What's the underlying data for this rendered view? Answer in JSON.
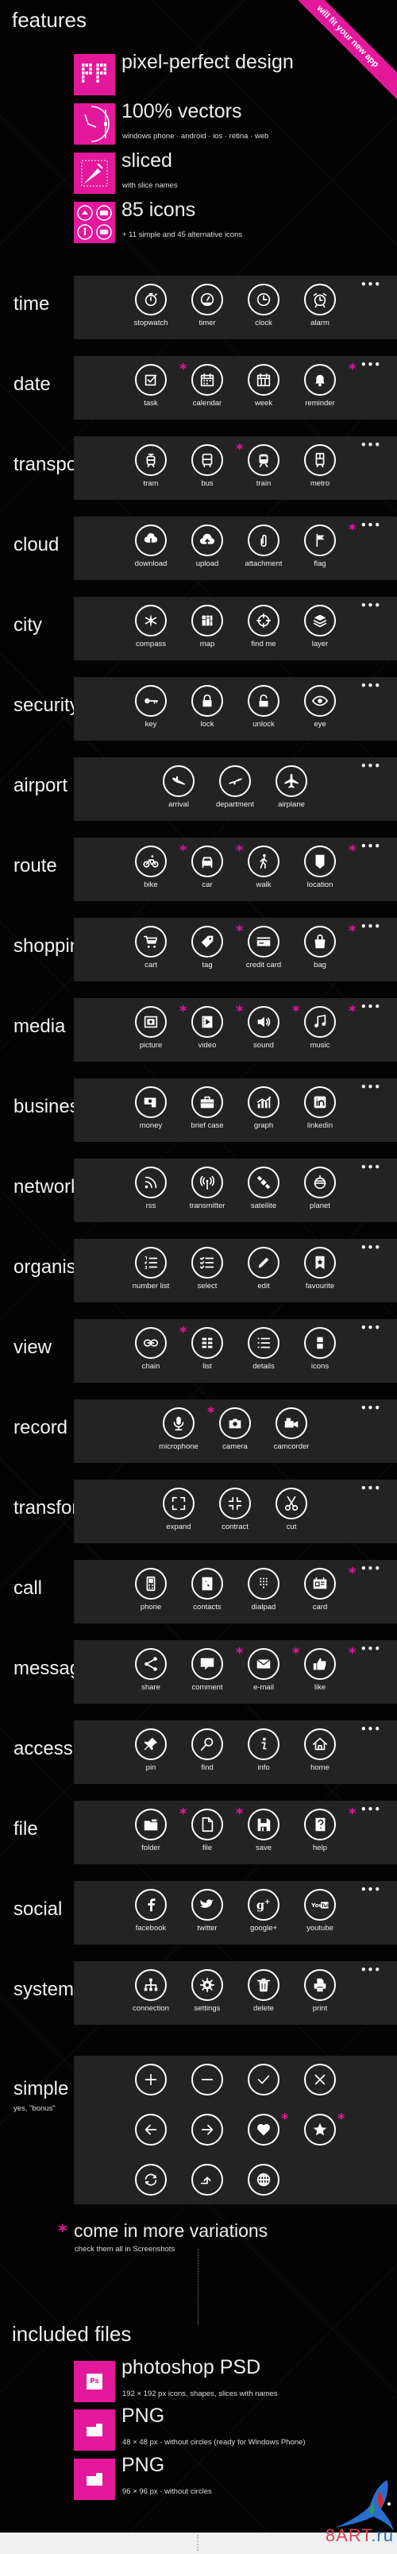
{
  "colors": {
    "accent": "#e3189b",
    "panel": "#232323",
    "background": "#030303"
  },
  "header": {
    "title": "features",
    "ribbon": "will fit your new app"
  },
  "features": [
    {
      "title": "pixel-perfect design",
      "subtitle": "",
      "icon": "pixel-pp-icon"
    },
    {
      "title": "100% vectors",
      "subtitle": "windows phone · android · ios · retina · web",
      "icon": "vector-path-icon"
    },
    {
      "title": "sliced",
      "subtitle": "with slice names",
      "icon": "slice-knife-icon"
    },
    {
      "title": "85 icons",
      "subtitle": "+ 11 simple and 45 alternative icons",
      "icon": "icon-grid-icon"
    }
  ],
  "more_label": "•••",
  "variant_marker": "*",
  "categories": [
    {
      "name": "time",
      "items": [
        {
          "label": "stopwatch",
          "icon": "stopwatch",
          "variant": false
        },
        {
          "label": "timer",
          "icon": "timer",
          "variant": false
        },
        {
          "label": "clock",
          "icon": "clock",
          "variant": false
        },
        {
          "label": "alarm",
          "icon": "alarm",
          "variant": false
        }
      ]
    },
    {
      "name": "date",
      "items": [
        {
          "label": "task",
          "icon": "task",
          "variant": true
        },
        {
          "label": "calendar",
          "icon": "calendar",
          "variant": false
        },
        {
          "label": "week",
          "icon": "week",
          "variant": false
        },
        {
          "label": "reminder",
          "icon": "reminder",
          "variant": true
        }
      ]
    },
    {
      "name": "transport",
      "items": [
        {
          "label": "tram",
          "icon": "tram",
          "variant": false
        },
        {
          "label": "bus",
          "icon": "bus",
          "variant": true
        },
        {
          "label": "train",
          "icon": "train",
          "variant": false
        },
        {
          "label": "metro",
          "icon": "metro",
          "variant": false
        }
      ]
    },
    {
      "name": "cloud",
      "items": [
        {
          "label": "download",
          "icon": "download",
          "variant": false
        },
        {
          "label": "upload",
          "icon": "upload",
          "variant": false
        },
        {
          "label": "attachment",
          "icon": "attachment",
          "variant": false
        },
        {
          "label": "flag",
          "icon": "flag",
          "variant": true
        }
      ]
    },
    {
      "name": "city",
      "items": [
        {
          "label": "compass",
          "icon": "compass",
          "variant": false
        },
        {
          "label": "map",
          "icon": "map",
          "variant": false
        },
        {
          "label": "find me",
          "icon": "find-me",
          "variant": false
        },
        {
          "label": "layer",
          "icon": "layer",
          "variant": false
        }
      ]
    },
    {
      "name": "security",
      "items": [
        {
          "label": "key",
          "icon": "key",
          "variant": false
        },
        {
          "label": "lock",
          "icon": "lock",
          "variant": false
        },
        {
          "label": "unlock",
          "icon": "unlock",
          "variant": false
        },
        {
          "label": "eye",
          "icon": "eye",
          "variant": false
        }
      ]
    },
    {
      "name": "airport",
      "items": [
        {
          "label": "arrival",
          "icon": "arrival",
          "variant": false
        },
        {
          "label": "department",
          "icon": "departure",
          "variant": false
        },
        {
          "label": "airplane",
          "icon": "airplane",
          "variant": false
        }
      ]
    },
    {
      "name": "route",
      "items": [
        {
          "label": "bike",
          "icon": "bike",
          "variant": true
        },
        {
          "label": "car",
          "icon": "car",
          "variant": true
        },
        {
          "label": "walk",
          "icon": "walk",
          "variant": false
        },
        {
          "label": "location",
          "icon": "location",
          "variant": true
        }
      ]
    },
    {
      "name": "shopping",
      "items": [
        {
          "label": "cart",
          "icon": "cart",
          "variant": false
        },
        {
          "label": "tag",
          "icon": "tag",
          "variant": true
        },
        {
          "label": "credit card",
          "icon": "credit-card",
          "variant": false
        },
        {
          "label": "bag",
          "icon": "bag",
          "variant": true
        }
      ]
    },
    {
      "name": "media",
      "items": [
        {
          "label": "picture",
          "icon": "picture",
          "variant": true
        },
        {
          "label": "video",
          "icon": "video",
          "variant": true
        },
        {
          "label": "sound",
          "icon": "sound",
          "variant": true
        },
        {
          "label": "music",
          "icon": "music",
          "variant": true
        }
      ]
    },
    {
      "name": "business",
      "items": [
        {
          "label": "money",
          "icon": "money",
          "variant": false
        },
        {
          "label": "brief case",
          "icon": "briefcase",
          "variant": false
        },
        {
          "label": "graph",
          "icon": "graph",
          "variant": false
        },
        {
          "label": "linkedin",
          "icon": "linkedin",
          "variant": false
        }
      ]
    },
    {
      "name": "network",
      "items": [
        {
          "label": "rss",
          "icon": "rss",
          "variant": false
        },
        {
          "label": "transmitter",
          "icon": "transmitter",
          "variant": false
        },
        {
          "label": "satellite",
          "icon": "satellite",
          "variant": false
        },
        {
          "label": "planet",
          "icon": "planet",
          "variant": false
        }
      ]
    },
    {
      "name": "organise",
      "items": [
        {
          "label": "number list",
          "icon": "number-list",
          "variant": false
        },
        {
          "label": "select",
          "icon": "select",
          "variant": false
        },
        {
          "label": "edit",
          "icon": "edit",
          "variant": false
        },
        {
          "label": "favourite",
          "icon": "favourite",
          "variant": false
        }
      ]
    },
    {
      "name": "view",
      "items": [
        {
          "label": "chain",
          "icon": "chain",
          "variant": true
        },
        {
          "label": "list",
          "icon": "list",
          "variant": false
        },
        {
          "label": "details",
          "icon": "details",
          "variant": false
        },
        {
          "label": "icons",
          "icon": "icons",
          "variant": false
        }
      ]
    },
    {
      "name": "record",
      "items": [
        {
          "label": "microphone",
          "icon": "microphone",
          "variant": true
        },
        {
          "label": "camera",
          "icon": "camera",
          "variant": false
        },
        {
          "label": "camcorder",
          "icon": "camcorder",
          "variant": false
        }
      ]
    },
    {
      "name": "transform",
      "items": [
        {
          "label": "expand",
          "icon": "expand",
          "variant": false
        },
        {
          "label": "contract",
          "icon": "contract",
          "variant": false
        },
        {
          "label": "cut",
          "icon": "cut",
          "variant": false
        }
      ]
    },
    {
      "name": "call",
      "items": [
        {
          "label": "phone",
          "icon": "phone",
          "variant": false
        },
        {
          "label": "contacts",
          "icon": "contacts",
          "variant": false
        },
        {
          "label": "dialpad",
          "icon": "dialpad",
          "variant": false
        },
        {
          "label": "card",
          "icon": "card",
          "variant": true
        }
      ]
    },
    {
      "name": "message",
      "items": [
        {
          "label": "share",
          "icon": "share",
          "variant": false
        },
        {
          "label": "comment",
          "icon": "comment",
          "variant": true
        },
        {
          "label": "e-mail",
          "icon": "email",
          "variant": true
        },
        {
          "label": "like",
          "icon": "like",
          "variant": true
        }
      ]
    },
    {
      "name": "access",
      "items": [
        {
          "label": "pin",
          "icon": "pin",
          "variant": false
        },
        {
          "label": "find",
          "icon": "find",
          "variant": false
        },
        {
          "label": "info",
          "icon": "info",
          "variant": false
        },
        {
          "label": "home",
          "icon": "home",
          "variant": false
        }
      ]
    },
    {
      "name": "file",
      "items": [
        {
          "label": "folder",
          "icon": "folder",
          "variant": true
        },
        {
          "label": "file",
          "icon": "file",
          "variant": true
        },
        {
          "label": "save",
          "icon": "save",
          "variant": false
        },
        {
          "label": "help",
          "icon": "help",
          "variant": true
        }
      ]
    },
    {
      "name": "social",
      "items": [
        {
          "label": "facebook",
          "icon": "facebook",
          "variant": false
        },
        {
          "label": "twitter",
          "icon": "twitter",
          "variant": false
        },
        {
          "label": "google+",
          "icon": "google-plus",
          "variant": false
        },
        {
          "label": "youtube",
          "icon": "youtube",
          "variant": false
        }
      ]
    },
    {
      "name": "system",
      "items": [
        {
          "label": "connection",
          "icon": "connection",
          "variant": false
        },
        {
          "label": "settings",
          "icon": "settings",
          "variant": false
        },
        {
          "label": "delete",
          "icon": "delete",
          "variant": false
        },
        {
          "label": "print",
          "icon": "print",
          "variant": false
        }
      ]
    }
  ],
  "simple": {
    "name": "simple",
    "subtitle": "yes, \"bonus\"",
    "rows": [
      [
        {
          "icon": "plus",
          "variant": false
        },
        {
          "icon": "minus",
          "variant": false
        },
        {
          "icon": "check",
          "variant": false
        },
        {
          "icon": "close",
          "variant": false
        }
      ],
      [
        {
          "icon": "arrow-left",
          "variant": false
        },
        {
          "icon": "arrow-right",
          "variant": false
        },
        {
          "icon": "heart",
          "variant": true
        },
        {
          "icon": "star",
          "variant": true
        }
      ],
      [
        {
          "icon": "refresh",
          "variant": false
        },
        {
          "icon": "turn-up",
          "variant": false
        },
        {
          "icon": "globe",
          "variant": false
        }
      ]
    ]
  },
  "variations": {
    "title": "come in more variations",
    "subtitle": "check them all in Screenshots"
  },
  "included": {
    "title": "included files",
    "files": [
      {
        "title": "photoshop PSD",
        "subtitle": "192 × 192 px icons, shapes, slices with names",
        "icon": "photoshop-icon",
        "badge": "Ps"
      },
      {
        "title": "PNG",
        "subtitle": "48 × 48 px · without circles (ready for Windows Phone)",
        "icon": "folder-icon",
        "badge": ""
      },
      {
        "title": "PNG",
        "subtitle": "96 × 96 px · without circles",
        "icon": "folder-icon",
        "badge": ""
      }
    ]
  },
  "watermark": {
    "brand": "8ART",
    "tld": ".ru"
  }
}
